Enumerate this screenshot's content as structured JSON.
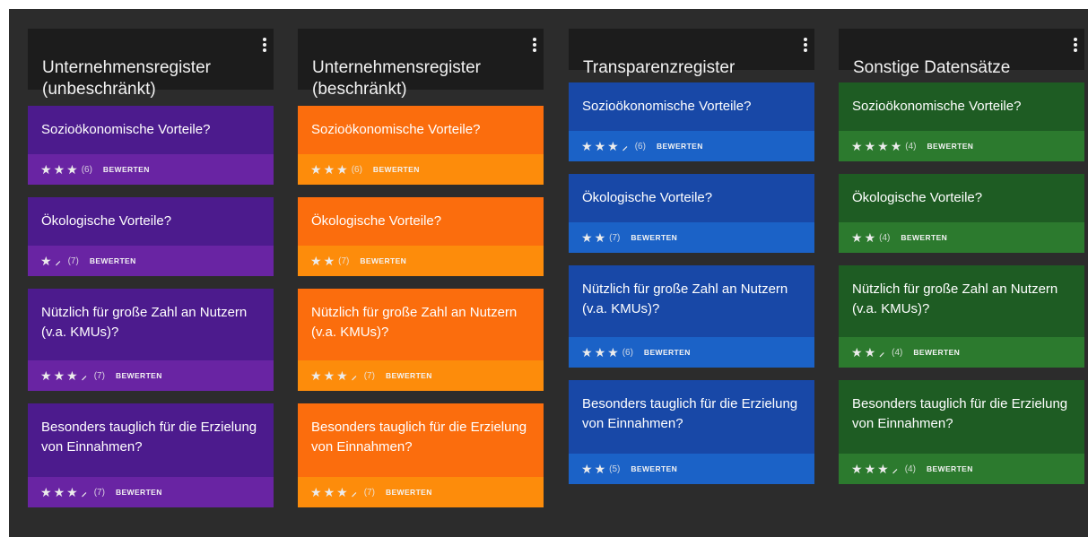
{
  "columns": [
    {
      "title": "Unternehmensregister\n(unbeschränkt)",
      "colors": {
        "top": "#4c1b8d",
        "bottom": "#6924a3"
      },
      "cards": [
        {
          "title": "Sozioökonomische Vorteile?",
          "stars": 3,
          "half": false,
          "count": "(6)",
          "rate": "BEWERTEN"
        },
        {
          "title": "Ökologische Vorteile?",
          "stars": 1,
          "half": true,
          "count": "(7)",
          "rate": "BEWERTEN"
        },
        {
          "title": "Nützlich für große Zahl an Nutzern (v.a. KMUs)?",
          "stars": 3,
          "half": true,
          "count": "(7)",
          "rate": "BEWERTEN"
        },
        {
          "title": "Besonders tauglich für die Erzielung von Einnahmen?",
          "stars": 3,
          "half": true,
          "count": "(7)",
          "rate": "BEWERTEN"
        }
      ]
    },
    {
      "title": "Unternehmensregister\n(beschränkt)",
      "colors": {
        "top": "#fb6d0d",
        "bottom": "#fd8c0b"
      },
      "cards": [
        {
          "title": "Sozioökonomische Vorteile?",
          "stars": 3,
          "half": false,
          "count": "(6)",
          "rate": "BEWERTEN"
        },
        {
          "title": "Ökologische Vorteile?",
          "stars": 2,
          "half": false,
          "count": "(7)",
          "rate": "BEWERTEN"
        },
        {
          "title": "Nützlich für große Zahl an Nutzern (v.a. KMUs)?",
          "stars": 3,
          "half": true,
          "count": "(7)",
          "rate": "BEWERTEN"
        },
        {
          "title": "Besonders tauglich für die Erzielung von Einnahmen?",
          "stars": 3,
          "half": true,
          "count": "(7)",
          "rate": "BEWERTEN"
        }
      ]
    },
    {
      "title": "Transparenzregister",
      "colors": {
        "top": "#1848a7",
        "bottom": "#1b62c7"
      },
      "cards": [
        {
          "title": "Sozioökonomische Vorteile?",
          "stars": 3,
          "half": true,
          "count": "(6)",
          "rate": "BEWERTEN"
        },
        {
          "title": "Ökologische Vorteile?",
          "stars": 2,
          "half": false,
          "count": "(7)",
          "rate": "BEWERTEN"
        },
        {
          "title": "Nützlich für große Zahl an Nutzern (v.a. KMUs)?",
          "stars": 3,
          "half": false,
          "count": "(6)",
          "rate": "BEWERTEN"
        },
        {
          "title": "Besonders tauglich für die Erzielung von Einnahmen?",
          "stars": 2,
          "half": false,
          "count": "(5)",
          "rate": "BEWERTEN"
        }
      ]
    },
    {
      "title": "Sonstige Datensätze",
      "colors": {
        "top": "#1e5c23",
        "bottom": "#2c7a2e"
      },
      "cards": [
        {
          "title": "Sozioökonomische Vorteile?",
          "stars": 4,
          "half": false,
          "count": "(4)",
          "rate": "BEWERTEN"
        },
        {
          "title": "Ökologische Vorteile?",
          "stars": 2,
          "half": false,
          "count": "(4)",
          "rate": "BEWERTEN"
        },
        {
          "title": "Nützlich für große Zahl an Nutzern (v.a. KMUs)?",
          "stars": 2,
          "half": true,
          "count": "(4)",
          "rate": "BEWERTEN"
        },
        {
          "title": "Besonders tauglich für die Erzielung von Einnahmen?",
          "stars": 3,
          "half": true,
          "count": "(4)",
          "rate": "BEWERTEN"
        }
      ]
    }
  ]
}
